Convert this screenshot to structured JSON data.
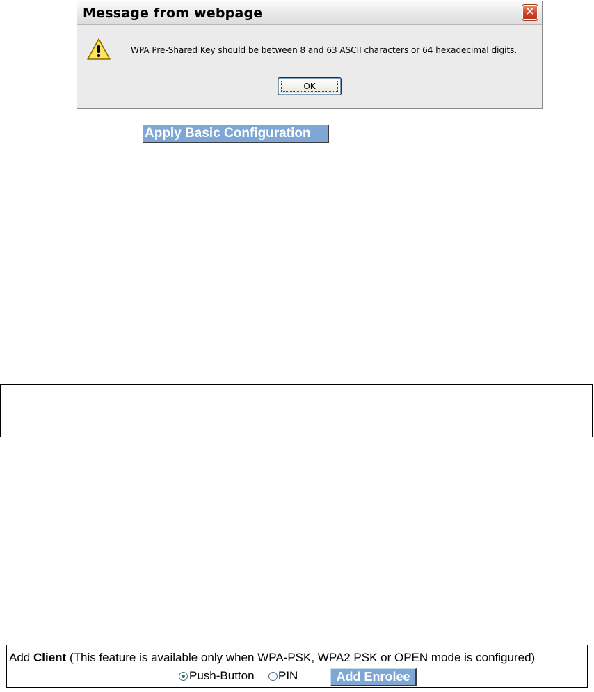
{
  "dialog": {
    "title": "Message from webpage",
    "close_label": "✕",
    "icon": "warning-icon",
    "message": "WPA Pre-Shared Key should be between 8 and 63 ASCII characters or 64 hexadecimal digits.",
    "ok_label": "OK"
  },
  "apply_button": {
    "label": "Apply Basic Configuration"
  },
  "client_panel": {
    "prefix": "Add ",
    "bold_word": "Client",
    "note": " (This feature is available only when WPA-PSK, WPA2 PSK or OPEN mode is configured)",
    "options": [
      {
        "label": "Push-Button",
        "selected": true
      },
      {
        "label": "PIN",
        "selected": false
      }
    ],
    "enrolee_label": "Add Enrolee"
  },
  "colors": {
    "button_blue": "#7fa7d6",
    "dialog_bg": "#ebebeb",
    "close_red": "#c9452a"
  }
}
